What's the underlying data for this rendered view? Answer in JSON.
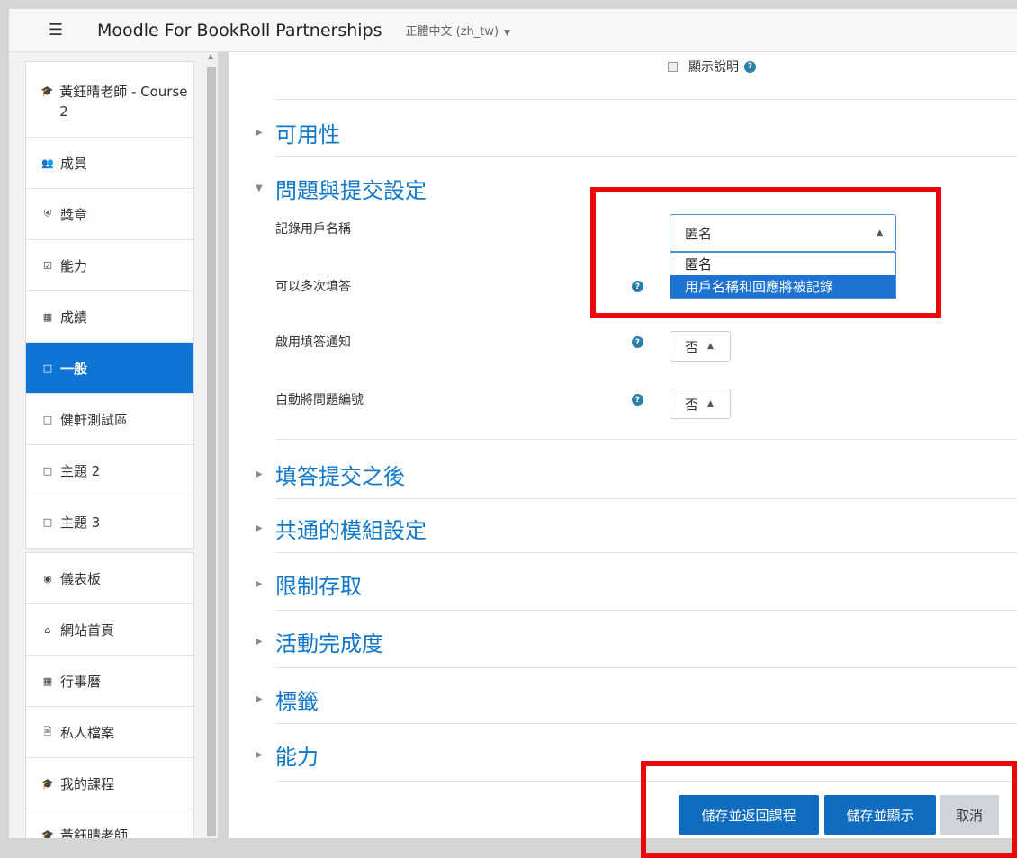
{
  "header": {
    "site_name": "Moodle For BookRoll Partnerships",
    "language": "正體中文 (zh_tw)",
    "menu_icon": "hamburger-icon"
  },
  "sidebar": {
    "course": [
      {
        "icon": "graduation-cap-icon",
        "label": "黃鈺晴老師 - Course 2"
      },
      {
        "icon": "users-icon",
        "label": "成員"
      },
      {
        "icon": "shield-icon",
        "label": "獎章"
      },
      {
        "icon": "checkbox-icon",
        "label": "能力"
      },
      {
        "icon": "table-icon",
        "label": "成績"
      },
      {
        "icon": "folder-icon",
        "label": "一般",
        "active": true
      },
      {
        "icon": "folder-icon",
        "label": "健軒測試區"
      },
      {
        "icon": "folder-icon",
        "label": "主題 2"
      },
      {
        "icon": "folder-icon",
        "label": "主題 3"
      }
    ],
    "site": [
      {
        "icon": "dashboard-icon",
        "label": "儀表板"
      },
      {
        "icon": "home-icon",
        "label": "網站首頁"
      },
      {
        "icon": "calendar-icon",
        "label": "行事曆"
      },
      {
        "icon": "file-icon",
        "label": "私人檔案"
      },
      {
        "icon": "graduation-cap-icon",
        "label": "我的課程"
      },
      {
        "icon": "graduation-cap-icon",
        "label": "黃鈺晴老師"
      }
    ]
  },
  "form": {
    "show_help_label": "顯示說明",
    "sections": {
      "availability": "可用性",
      "questions": "問題與提交設定",
      "after_submit": "填答提交之後",
      "common_module": "共通的模組設定",
      "restrict": "限制存取",
      "completion": "活動完成度",
      "tags": "標籤",
      "competencies": "能力"
    },
    "fields": {
      "record_names": {
        "label": "記錄用戶名稱",
        "value": "匿名",
        "options": [
          "匿名",
          "用戶名稱和回應將被記錄"
        ],
        "highlighted": "用戶名稱和回應將被記錄"
      },
      "multiple": {
        "label": "可以多次填答"
      },
      "notify": {
        "label": "啟用填答通知",
        "value": "否"
      },
      "autonumber": {
        "label": "自動將問題編號",
        "value": "否"
      }
    },
    "buttons": {
      "save_return": "儲存並返回課程",
      "save_display": "儲存並顯示",
      "cancel": "取消"
    }
  },
  "colors": {
    "accent": "#0f75d4",
    "section_link": "#1177c9",
    "annotation": "#e8090b"
  }
}
